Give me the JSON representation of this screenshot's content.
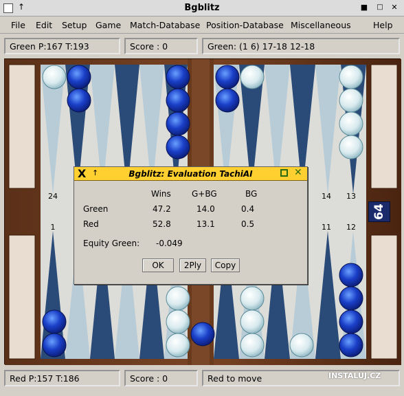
{
  "window": {
    "title": "Bgblitz",
    "minimize_icon": "minimize-icon",
    "maximize_icon": "maximize-icon",
    "close_icon": "close-icon"
  },
  "menu": [
    "File",
    "Edit",
    "Setup",
    "Game",
    "Match-Database",
    "Position-Database",
    "Miscellaneous",
    "Help"
  ],
  "status_top": {
    "player": "Green  P:167  T:193",
    "score": "Score : 0",
    "move": "Green: (1 6) 17-18 12-18"
  },
  "status_bottom": {
    "player": "Red  P:157  T:186",
    "score": "Score : 0",
    "message": "Red to move"
  },
  "board": {
    "point_labels_top": [
      "24",
      "14",
      "13"
    ],
    "point_labels_bottom": [
      "1",
      "11",
      "12"
    ],
    "dice_value": "64",
    "colors": {
      "blue_checker": "#1a3fc8",
      "white_checker": "#e8f2f4",
      "frame": "#4a2a18"
    }
  },
  "dialog": {
    "title": "Bgblitz: Evaluation TachiAI",
    "headers": [
      "Wins",
      "G+BG",
      "BG"
    ],
    "rows": [
      {
        "label": "Green",
        "wins": "47.2",
        "gbg": "14.0",
        "bg": "0.4"
      },
      {
        "label": "Red",
        "wins": "52.8",
        "gbg": "13.1",
        "bg": "0.5"
      }
    ],
    "equity_label": "Equity Green:",
    "equity_value": "-0.049",
    "buttons": [
      "OK",
      "2Ply",
      "Copy"
    ]
  },
  "watermark": "INSTALUJ.CZ"
}
